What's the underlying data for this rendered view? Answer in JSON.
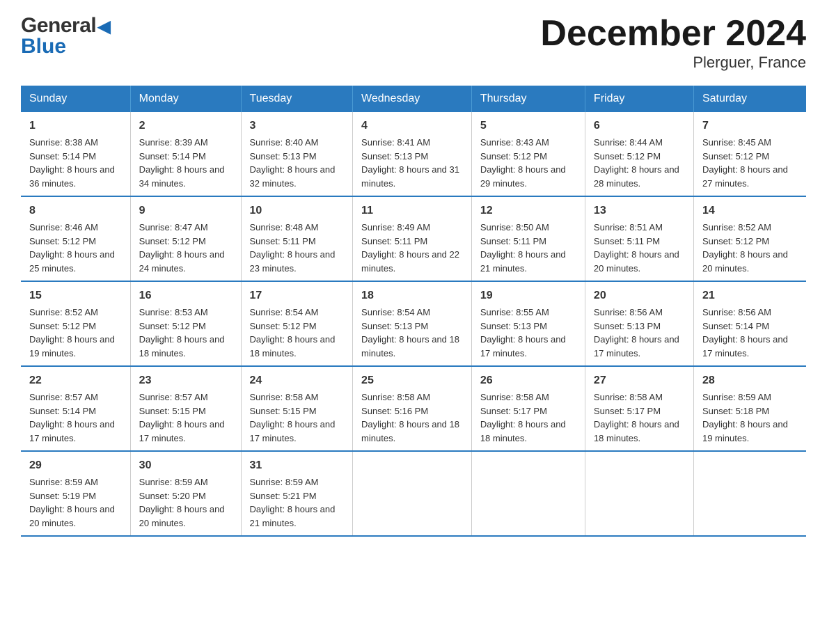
{
  "logo": {
    "top": "General",
    "bottom": "Blue"
  },
  "title": "December 2024",
  "subtitle": "Plerguer, France",
  "days_header": [
    "Sunday",
    "Monday",
    "Tuesday",
    "Wednesday",
    "Thursday",
    "Friday",
    "Saturday"
  ],
  "weeks": [
    [
      {
        "num": "1",
        "sunrise": "8:38 AM",
        "sunset": "5:14 PM",
        "daylight": "8 hours and 36 minutes."
      },
      {
        "num": "2",
        "sunrise": "8:39 AM",
        "sunset": "5:14 PM",
        "daylight": "8 hours and 34 minutes."
      },
      {
        "num": "3",
        "sunrise": "8:40 AM",
        "sunset": "5:13 PM",
        "daylight": "8 hours and 32 minutes."
      },
      {
        "num": "4",
        "sunrise": "8:41 AM",
        "sunset": "5:13 PM",
        "daylight": "8 hours and 31 minutes."
      },
      {
        "num": "5",
        "sunrise": "8:43 AM",
        "sunset": "5:12 PM",
        "daylight": "8 hours and 29 minutes."
      },
      {
        "num": "6",
        "sunrise": "8:44 AM",
        "sunset": "5:12 PM",
        "daylight": "8 hours and 28 minutes."
      },
      {
        "num": "7",
        "sunrise": "8:45 AM",
        "sunset": "5:12 PM",
        "daylight": "8 hours and 27 minutes."
      }
    ],
    [
      {
        "num": "8",
        "sunrise": "8:46 AM",
        "sunset": "5:12 PM",
        "daylight": "8 hours and 25 minutes."
      },
      {
        "num": "9",
        "sunrise": "8:47 AM",
        "sunset": "5:12 PM",
        "daylight": "8 hours and 24 minutes."
      },
      {
        "num": "10",
        "sunrise": "8:48 AM",
        "sunset": "5:11 PM",
        "daylight": "8 hours and 23 minutes."
      },
      {
        "num": "11",
        "sunrise": "8:49 AM",
        "sunset": "5:11 PM",
        "daylight": "8 hours and 22 minutes."
      },
      {
        "num": "12",
        "sunrise": "8:50 AM",
        "sunset": "5:11 PM",
        "daylight": "8 hours and 21 minutes."
      },
      {
        "num": "13",
        "sunrise": "8:51 AM",
        "sunset": "5:11 PM",
        "daylight": "8 hours and 20 minutes."
      },
      {
        "num": "14",
        "sunrise": "8:52 AM",
        "sunset": "5:12 PM",
        "daylight": "8 hours and 20 minutes."
      }
    ],
    [
      {
        "num": "15",
        "sunrise": "8:52 AM",
        "sunset": "5:12 PM",
        "daylight": "8 hours and 19 minutes."
      },
      {
        "num": "16",
        "sunrise": "8:53 AM",
        "sunset": "5:12 PM",
        "daylight": "8 hours and 18 minutes."
      },
      {
        "num": "17",
        "sunrise": "8:54 AM",
        "sunset": "5:12 PM",
        "daylight": "8 hours and 18 minutes."
      },
      {
        "num": "18",
        "sunrise": "8:54 AM",
        "sunset": "5:13 PM",
        "daylight": "8 hours and 18 minutes."
      },
      {
        "num": "19",
        "sunrise": "8:55 AM",
        "sunset": "5:13 PM",
        "daylight": "8 hours and 17 minutes."
      },
      {
        "num": "20",
        "sunrise": "8:56 AM",
        "sunset": "5:13 PM",
        "daylight": "8 hours and 17 minutes."
      },
      {
        "num": "21",
        "sunrise": "8:56 AM",
        "sunset": "5:14 PM",
        "daylight": "8 hours and 17 minutes."
      }
    ],
    [
      {
        "num": "22",
        "sunrise": "8:57 AM",
        "sunset": "5:14 PM",
        "daylight": "8 hours and 17 minutes."
      },
      {
        "num": "23",
        "sunrise": "8:57 AM",
        "sunset": "5:15 PM",
        "daylight": "8 hours and 17 minutes."
      },
      {
        "num": "24",
        "sunrise": "8:58 AM",
        "sunset": "5:15 PM",
        "daylight": "8 hours and 17 minutes."
      },
      {
        "num": "25",
        "sunrise": "8:58 AM",
        "sunset": "5:16 PM",
        "daylight": "8 hours and 18 minutes."
      },
      {
        "num": "26",
        "sunrise": "8:58 AM",
        "sunset": "5:17 PM",
        "daylight": "8 hours and 18 minutes."
      },
      {
        "num": "27",
        "sunrise": "8:58 AM",
        "sunset": "5:17 PM",
        "daylight": "8 hours and 18 minutes."
      },
      {
        "num": "28",
        "sunrise": "8:59 AM",
        "sunset": "5:18 PM",
        "daylight": "8 hours and 19 minutes."
      }
    ],
    [
      {
        "num": "29",
        "sunrise": "8:59 AM",
        "sunset": "5:19 PM",
        "daylight": "8 hours and 20 minutes."
      },
      {
        "num": "30",
        "sunrise": "8:59 AM",
        "sunset": "5:20 PM",
        "daylight": "8 hours and 20 minutes."
      },
      {
        "num": "31",
        "sunrise": "8:59 AM",
        "sunset": "5:21 PM",
        "daylight": "8 hours and 21 minutes."
      },
      null,
      null,
      null,
      null
    ]
  ],
  "labels": {
    "sunrise": "Sunrise:",
    "sunset": "Sunset:",
    "daylight": "Daylight:"
  }
}
